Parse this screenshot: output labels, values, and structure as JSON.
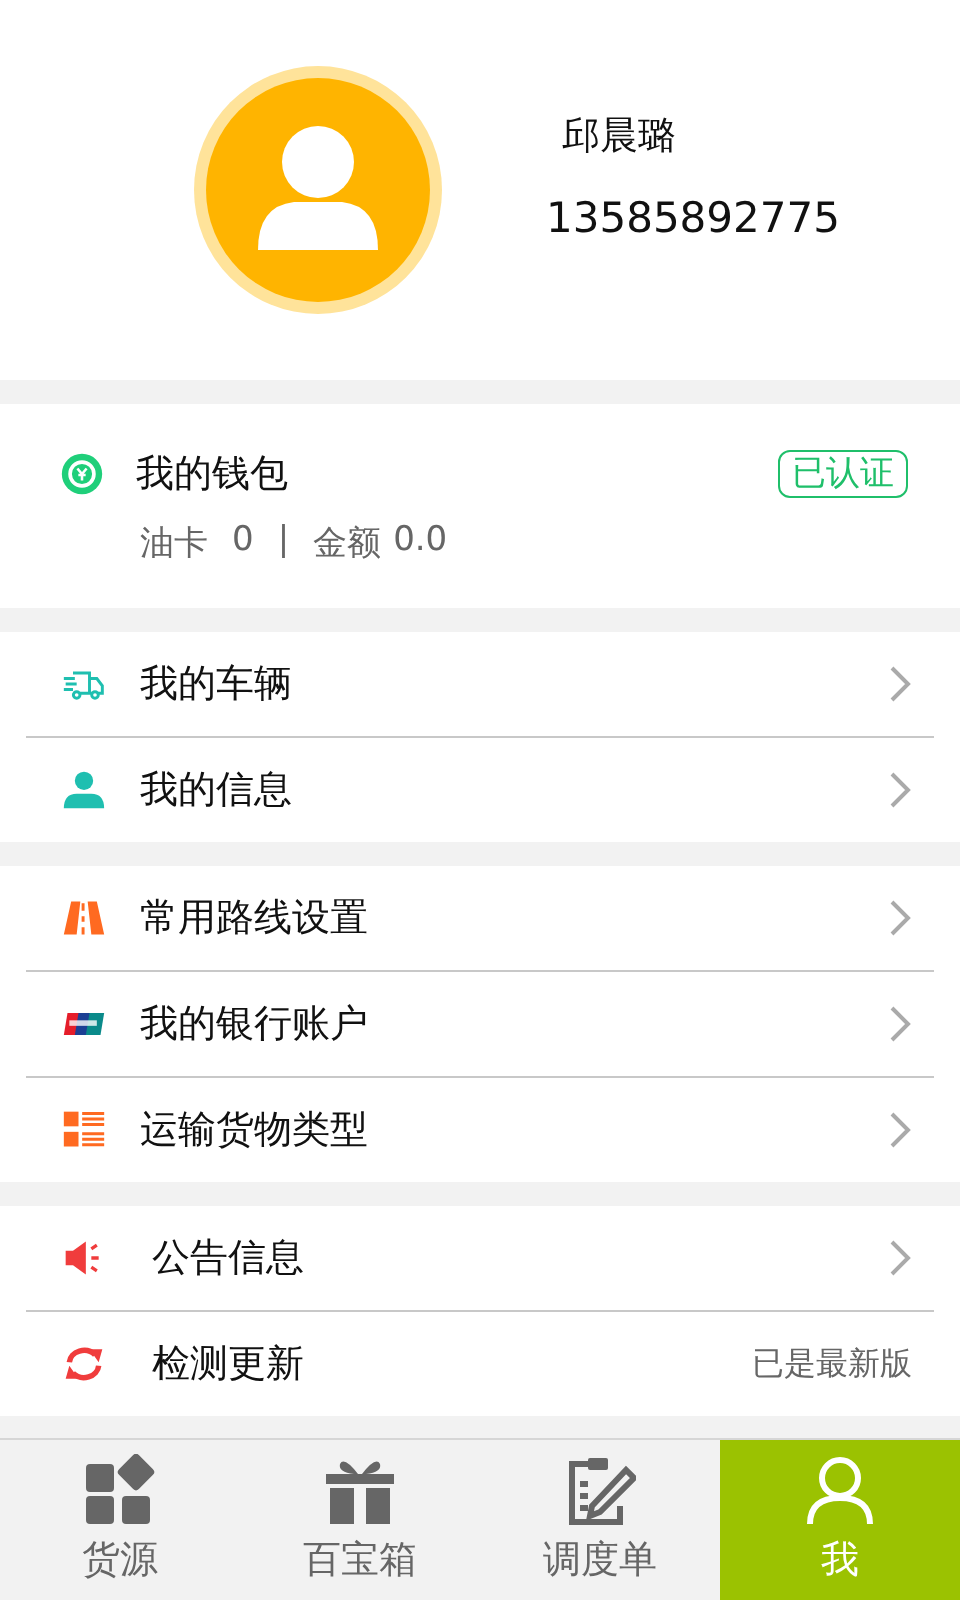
{
  "profile": {
    "name": "邱晨璐",
    "phone": "13585892775"
  },
  "wallet": {
    "title": "我的钱包",
    "badge": "已认证",
    "oil_card_label": "油卡",
    "oil_card_value": "0",
    "separator": "|",
    "balance_label": "金额",
    "balance_value": "0.0"
  },
  "menu_groups": [
    {
      "items": [
        {
          "kind": "truck",
          "label": "我的车辆"
        },
        {
          "kind": "person",
          "label": "我的信息"
        }
      ]
    },
    {
      "items": [
        {
          "kind": "road",
          "label": "常用路线设置"
        },
        {
          "kind": "card",
          "label": "我的银行账户"
        },
        {
          "kind": "list",
          "label": "运输货物类型"
        }
      ]
    },
    {
      "items": [
        {
          "kind": "speaker",
          "label": "公告信息"
        },
        {
          "kind": "refresh",
          "label": "检测更新",
          "status": "已是最新版"
        }
      ]
    }
  ],
  "tabs": [
    {
      "kind": "grid",
      "label": "货源",
      "selected": false
    },
    {
      "kind": "gift",
      "label": "百宝箱",
      "selected": false
    },
    {
      "kind": "clipboard",
      "label": "调度单",
      "selected": false
    },
    {
      "kind": "user",
      "label": "我",
      "selected": true
    }
  ]
}
